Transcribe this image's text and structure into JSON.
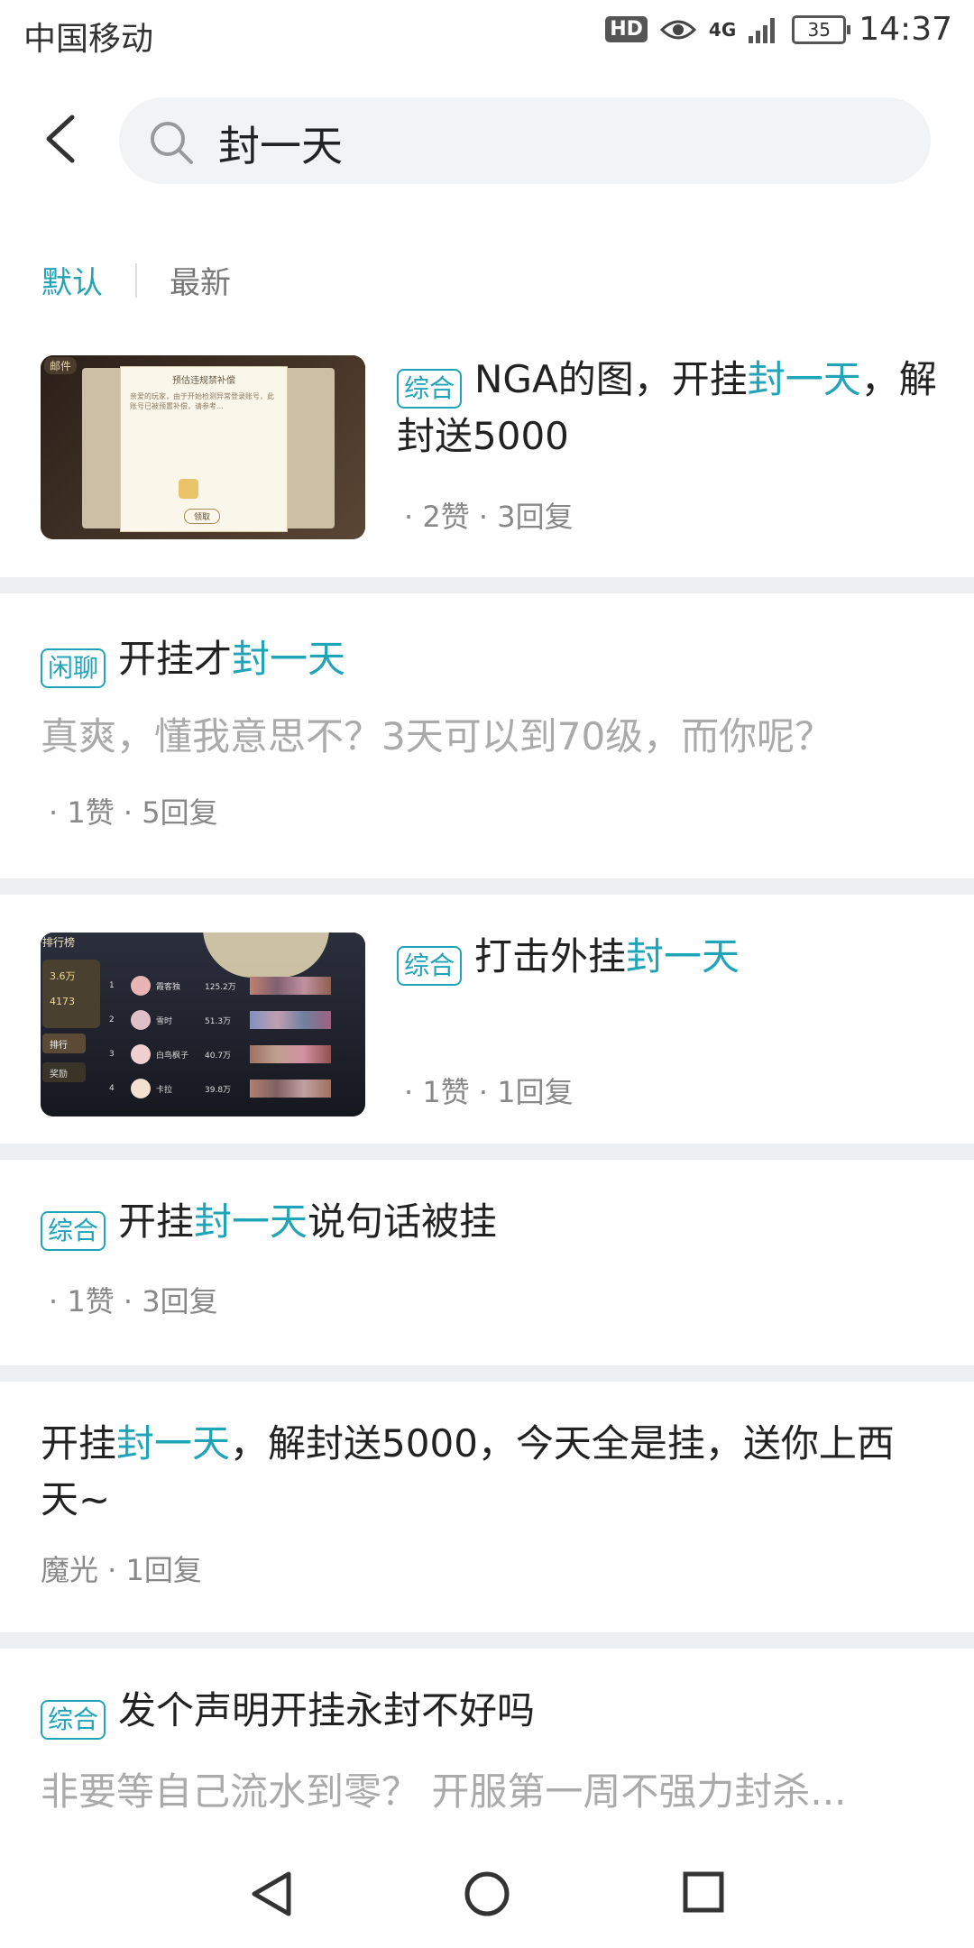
{
  "status": {
    "carrier": "中国移动",
    "hd": "HD",
    "network": "4G",
    "battery": "35",
    "time": "14:37"
  },
  "search": {
    "query": "封一天"
  },
  "sort_tabs": [
    {
      "label": "默认",
      "active": true
    },
    {
      "label": "最新",
      "active": false
    }
  ],
  "posts": [
    {
      "tag": "综合",
      "title_parts": [
        "NGA的图，开挂",
        "封一天",
        "，解封送5000"
      ],
      "meta": "· 2赞 · 3回复",
      "has_thumb": true
    },
    {
      "tag": "闲聊",
      "title_parts": [
        "开挂才",
        "封一天",
        ""
      ],
      "excerpt": "真爽，懂我意思不？3天可以到70级，而你呢？",
      "meta": "· 1赞 · 5回复"
    },
    {
      "tag": "综合",
      "title_parts": [
        "打击外挂",
        "封一天",
        ""
      ],
      "meta": "· 1赞 · 1回复",
      "has_thumb": true
    },
    {
      "tag": "综合",
      "title_parts": [
        "开挂",
        "封一天",
        "说句话被挂"
      ],
      "meta": "· 1赞 · 3回复"
    },
    {
      "tag": "",
      "title_parts": [
        "开挂",
        "封一天",
        "，解封送5000，今天全是挂，送你上西天~"
      ],
      "meta": "魔光 · 1回复"
    },
    {
      "tag": "综合",
      "title_parts": [
        "发个声明开挂永封不好吗",
        "",
        ""
      ],
      "excerpt": "非要等自己流水到零？ 开服第一周不强力封杀..."
    }
  ],
  "thumb1": {
    "header": "邮件",
    "dialog_title": "预估违规禁补偿",
    "dialog_body": "亲爱的玩家，由于开始检测异常登录账号，此账号已被预置补偿，请参考...",
    "button": "领取"
  },
  "thumb2": {
    "header": "排行榜",
    "stats": [
      "3.6万",
      "4173"
    ],
    "menu": [
      "排行",
      "奖励"
    ],
    "rows": [
      {
        "rank": "1",
        "name": "霞客独",
        "score": "125.2万"
      },
      {
        "rank": "2",
        "name": "雪时",
        "score": "51.3万"
      },
      {
        "rank": "3",
        "name": "白鸟枫子",
        "score": "40.7万"
      },
      {
        "rank": "4",
        "name": "卡拉",
        "score": "39.8万"
      }
    ]
  },
  "colors": {
    "accent": "#1fa4b8",
    "separator": "#eeeff1"
  },
  "nav": {
    "back": "back-triangle-icon",
    "home": "home-circle-icon",
    "recent": "recent-square-icon"
  }
}
